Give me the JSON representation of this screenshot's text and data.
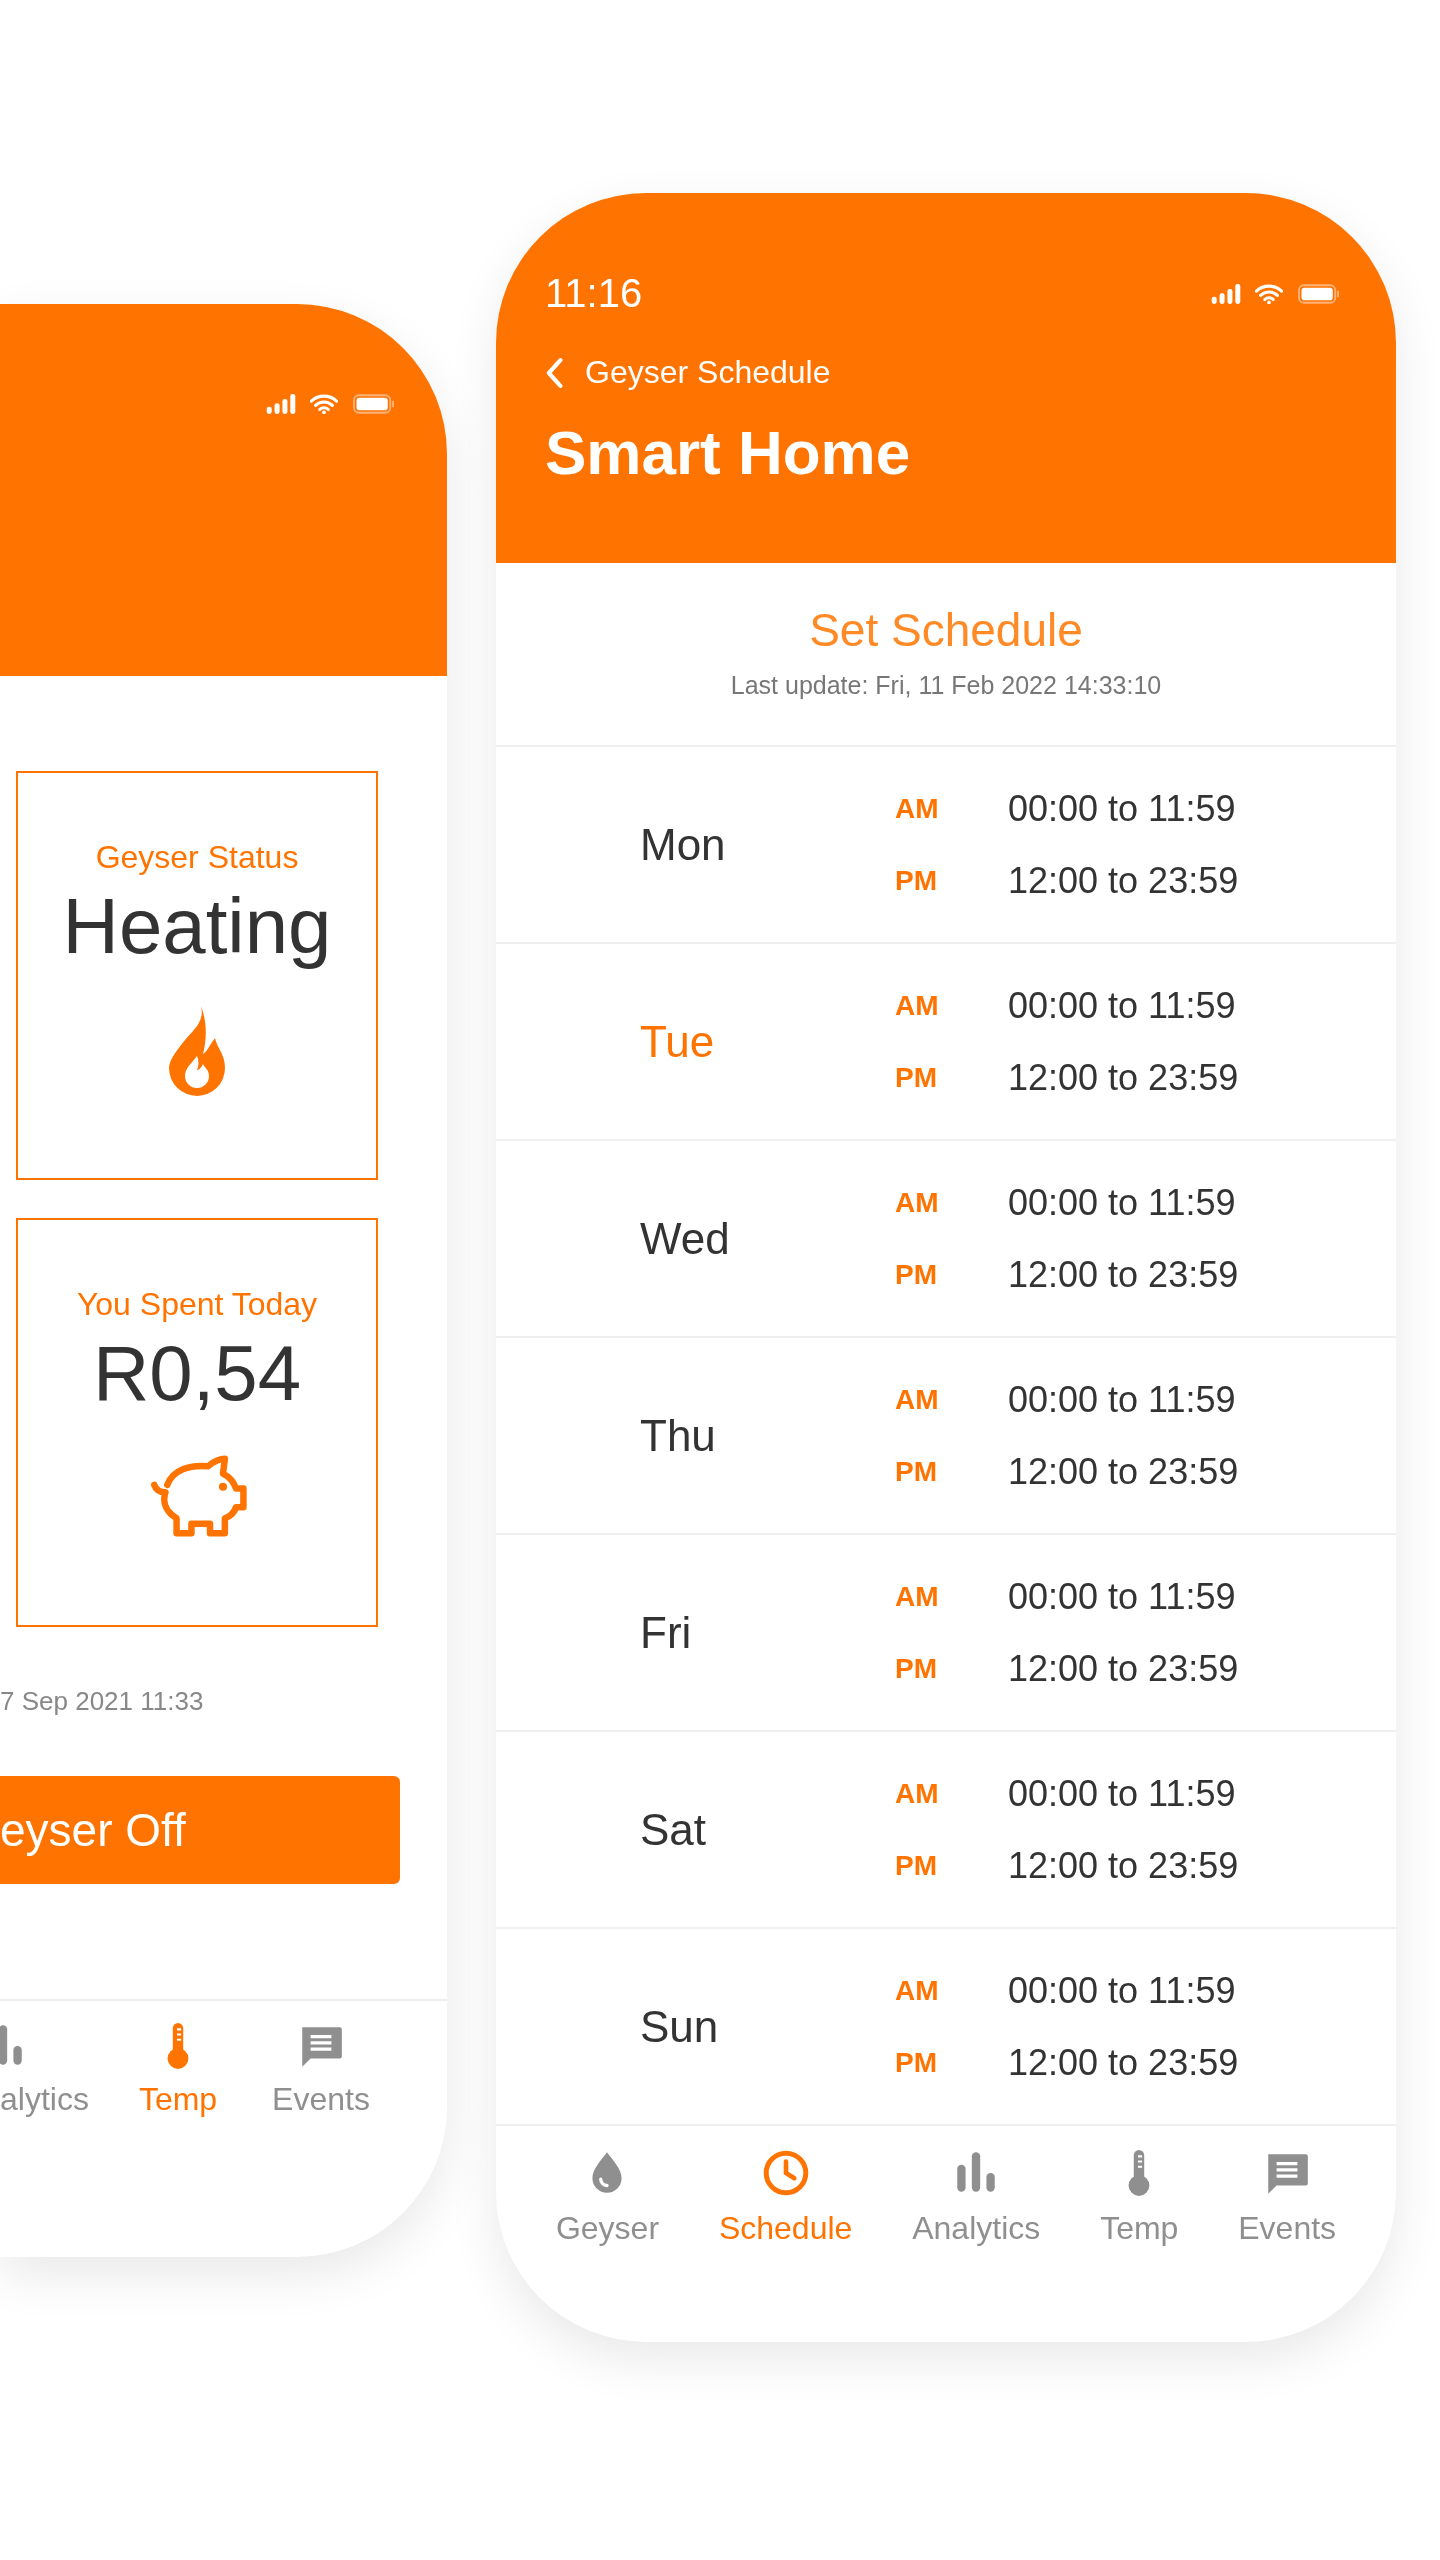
{
  "left_screen": {
    "cards": [
      {
        "kind": "status",
        "label": "Geyser Status",
        "value": "Heating"
      },
      {
        "kind": "spend",
        "label": "You Spent Today",
        "value": "R0,54"
      }
    ],
    "last_update": "7 Sep 2021 11:33",
    "button": "eyser Off",
    "nav": [
      {
        "kind": "analytics",
        "label": "alytics",
        "selected": false
      },
      {
        "kind": "temp",
        "label": "Temp",
        "selected": true
      },
      {
        "kind": "events",
        "label": "Events",
        "selected": false
      }
    ]
  },
  "right_screen": {
    "status_bar": {
      "time": "11:16"
    },
    "back_label": "Geyser Schedule",
    "title": "Smart Home",
    "section_title": "Set Schedule",
    "last_update": "Last update: Fri, 11 Feb 2022 14:33:10",
    "schedule": [
      {
        "day": "Mon",
        "selected": false,
        "slots": [
          {
            "period": "AM",
            "range": "00:00 to 11:59"
          },
          {
            "period": "PM",
            "range": "12:00 to 23:59"
          }
        ]
      },
      {
        "day": "Tue",
        "selected": true,
        "slots": [
          {
            "period": "AM",
            "range": "00:00 to 11:59"
          },
          {
            "period": "PM",
            "range": "12:00 to 23:59"
          }
        ]
      },
      {
        "day": "Wed",
        "selected": false,
        "slots": [
          {
            "period": "AM",
            "range": "00:00 to 11:59"
          },
          {
            "period": "PM",
            "range": "12:00 to 23:59"
          }
        ]
      },
      {
        "day": "Thu",
        "selected": false,
        "slots": [
          {
            "period": "AM",
            "range": "00:00 to 11:59"
          },
          {
            "period": "PM",
            "range": "12:00 to 23:59"
          }
        ]
      },
      {
        "day": "Fri",
        "selected": false,
        "slots": [
          {
            "period": "AM",
            "range": "00:00 to 11:59"
          },
          {
            "period": "PM",
            "range": "12:00 to 23:59"
          }
        ]
      },
      {
        "day": "Sat",
        "selected": false,
        "slots": [
          {
            "period": "AM",
            "range": "00:00 to 11:59"
          },
          {
            "period": "PM",
            "range": "12:00 to 23:59"
          }
        ]
      },
      {
        "day": "Sun",
        "selected": false,
        "slots": [
          {
            "period": "AM",
            "range": "00:00 to 11:59"
          },
          {
            "period": "PM",
            "range": "12:00 to 23:59"
          }
        ]
      }
    ],
    "nav": [
      {
        "kind": "geyser",
        "label": "Geyser",
        "selected": false
      },
      {
        "kind": "schedule",
        "label": "Schedule",
        "selected": true
      },
      {
        "kind": "analytics",
        "label": "Analytics",
        "selected": false
      },
      {
        "kind": "temp",
        "label": "Temp",
        "selected": false
      },
      {
        "kind": "events",
        "label": "Events",
        "selected": false
      }
    ]
  }
}
